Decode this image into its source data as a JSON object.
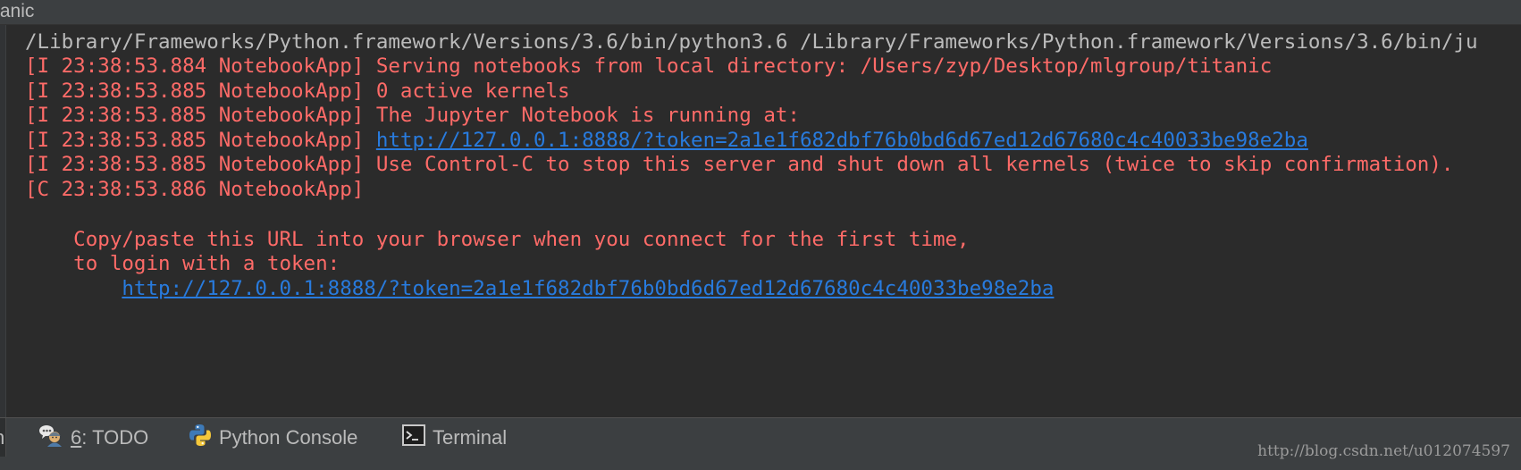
{
  "window": {
    "title": "tanic"
  },
  "console": {
    "command": "/Library/Frameworks/Python.framework/Versions/3.6/bin/python3.6 /Library/Frameworks/Python.framework/Versions/3.6/bin/ju",
    "lines": [
      {
        "text": "[I 23:38:53.884 NotebookApp] Serving notebooks from local directory: /Users/zyp/Desktop/mlgroup/titanic"
      },
      {
        "text": "[I 23:38:53.885 NotebookApp] 0 active kernels"
      },
      {
        "text": "[I 23:38:53.885 NotebookApp] The Jupyter Notebook is running at:"
      },
      {
        "prefix": "[I 23:38:53.885 NotebookApp] ",
        "link": "http://127.0.0.1:8888/?token=2a1e1f682dbf76b0bd6d67ed12d67680c4c40033be98e2ba"
      },
      {
        "text": "[I 23:38:53.885 NotebookApp] Use Control-C to stop this server and shut down all kernels (twice to skip confirmation)."
      },
      {
        "text": "[C 23:38:53.886 NotebookApp] "
      }
    ],
    "copy_paste_1": "    Copy/paste this URL into your browser when you connect for the first time,",
    "copy_paste_2": "    to login with a token:",
    "token_url_indent": "        ",
    "token_url": "http://127.0.0.1:8888/?token=2a1e1f682dbf76b0bd6d67ed12d67680c4c40033be98e2ba"
  },
  "toolbar": {
    "partial_tab": "n",
    "todo_mnemonic": "6",
    "todo_label": ": TODO",
    "python_console_label": "Python Console",
    "terminal_label": "Terminal"
  },
  "watermark": "http://blog.csdn.net/u012074597",
  "colors": {
    "background": "#2b2b2b",
    "toolbar": "#3c3f41",
    "error_text": "#ff6b68",
    "command_text": "#bbbbbb",
    "link": "#287bde"
  }
}
